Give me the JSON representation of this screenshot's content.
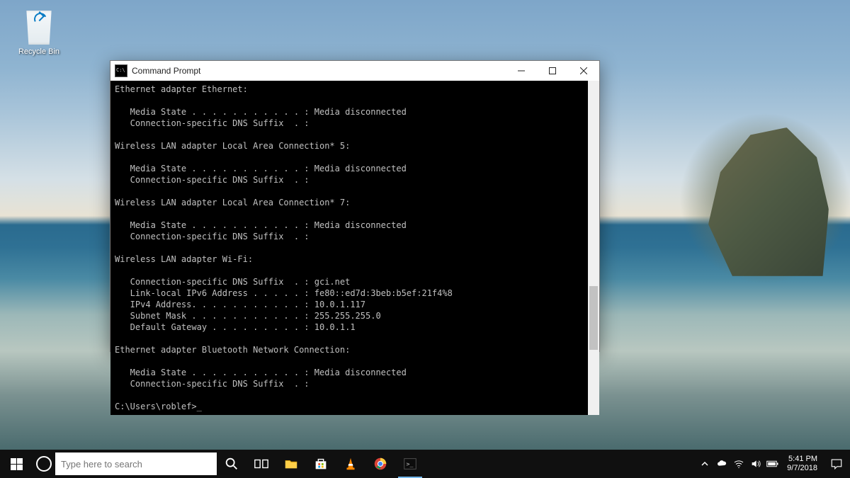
{
  "desktop": {
    "recycle_bin_label": "Recycle Bin"
  },
  "window": {
    "title": "Command Prompt",
    "terminal_output": "Ethernet adapter Ethernet:\n\n   Media State . . . . . . . . . . . : Media disconnected\n   Connection-specific DNS Suffix  . :\n\nWireless LAN adapter Local Area Connection* 5:\n\n   Media State . . . . . . . . . . . : Media disconnected\n   Connection-specific DNS Suffix  . :\n\nWireless LAN adapter Local Area Connection* 7:\n\n   Media State . . . . . . . . . . . : Media disconnected\n   Connection-specific DNS Suffix  . :\n\nWireless LAN adapter Wi-Fi:\n\n   Connection-specific DNS Suffix  . : gci.net\n   Link-local IPv6 Address . . . . . : fe80::ed7d:3beb:b5ef:21f4%8\n   IPv4 Address. . . . . . . . . . . : 10.0.1.117\n   Subnet Mask . . . . . . . . . . . : 255.255.255.0\n   Default Gateway . . . . . . . . . : 10.0.1.1\n\nEthernet adapter Bluetooth Network Connection:\n\n   Media State . . . . . . . . . . . : Media disconnected\n   Connection-specific DNS Suffix  . :\n\nC:\\Users\\roblef>_"
  },
  "taskbar": {
    "search_placeholder": "Type here to search",
    "clock_time": "5:41 PM",
    "clock_date": "9/7/2018"
  }
}
